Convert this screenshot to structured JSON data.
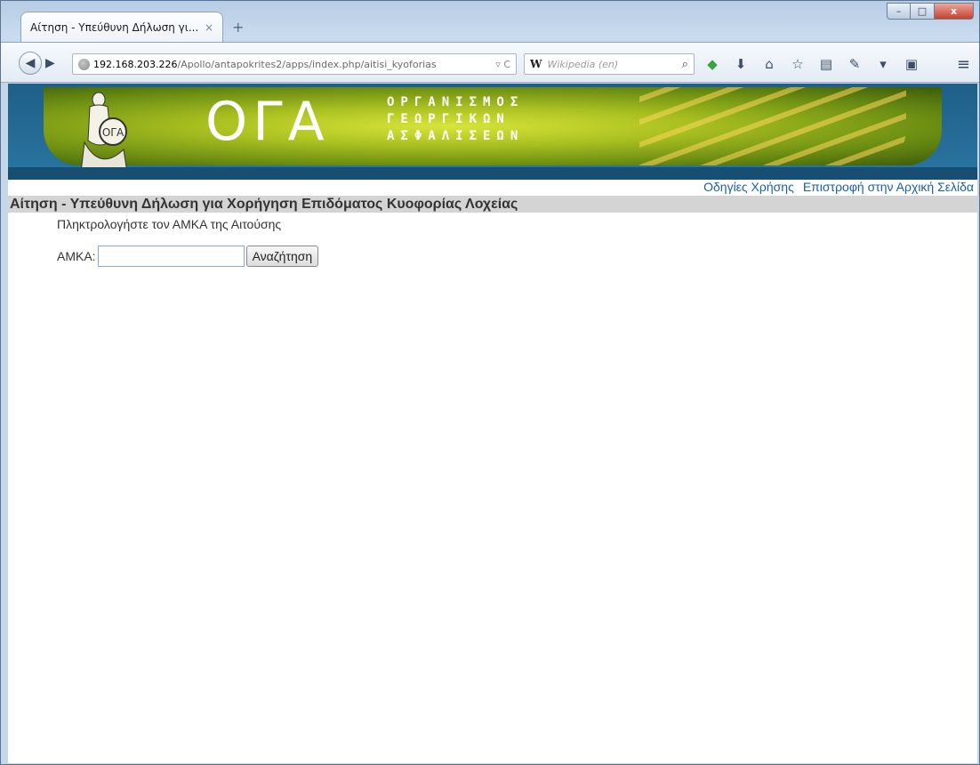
{
  "browser": {
    "tab_title": "Αίτηση - Υπεύθυνη Δήλωση γι...",
    "tab_close": "×",
    "new_tab": "+",
    "url_host": "192.168.203.226",
    "url_path": "/Apollo/antapokrites2/apps/index.php/aitisi_kyoforias",
    "search_engine": "W",
    "search_placeholder": "Wikipedia (en)",
    "window_controls": {
      "minimize": "–",
      "maximize": "□",
      "close": "x"
    }
  },
  "banner": {
    "logo_text": "ΟΓΑ",
    "org_line1": "ΟΡΓΑΝΙΣΜΟΣ",
    "org_line2": "ΓΕΩΡΓΙΚΩΝ",
    "org_line3": "ΑΣΦΑΛΙΣΕΩΝ"
  },
  "links": {
    "help": "Οδηγίες Χρήσης",
    "home": "Επιστροφή στην Αρχική Σελίδα"
  },
  "page": {
    "title": "Αίτηση - Υπεύθυνη Δήλωση για Χορήγηση Επιδόματος Κυοφορίας Λοχείας",
    "instruction": "Πληκτρολογήστε τον ΑΜΚΑ της Αιτούσης",
    "amka_label": "ΑΜΚΑ:",
    "amka_value": "",
    "search_button": "Αναζήτηση"
  }
}
